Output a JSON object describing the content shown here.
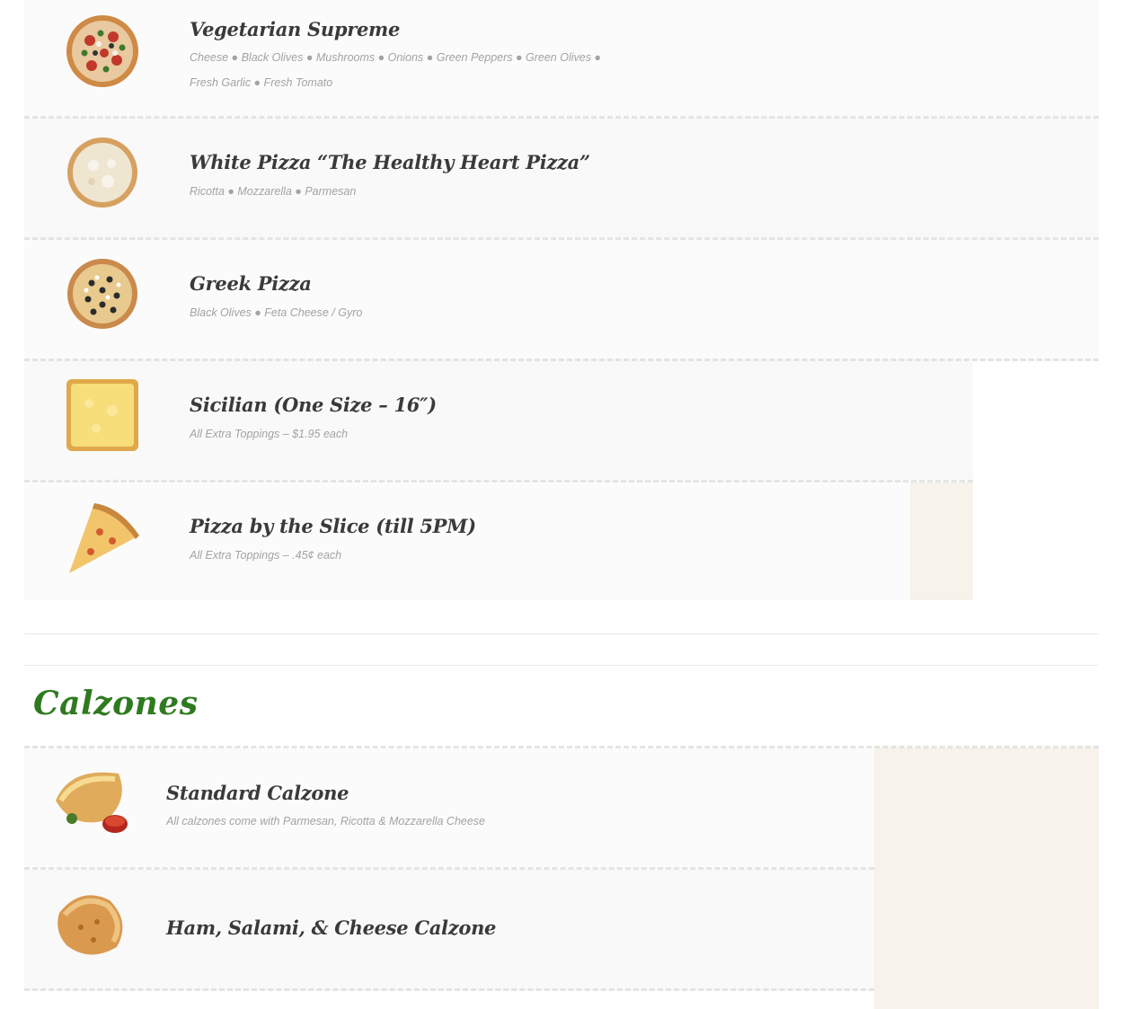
{
  "colors": {
    "section_heading": "#2f7a20",
    "item_title": "#3a3a3a",
    "item_description": "#a3a3a3",
    "price_column": "#f7f2ea",
    "row_divider": "#e4e4e4"
  },
  "pizzas": [
    {
      "title": "Vegetarian Supreme",
      "desc_line1": "Cheese ● Black Olives ● Mushrooms ● Onions ● Green Peppers ● Green Olives ●",
      "desc_line2": "Fresh Garlic ● Fresh Tomato",
      "icon": "vegetarian-pizza-icon"
    },
    {
      "title": "White Pizza “The Healthy Heart Pizza”",
      "desc_line1": "Ricotta ● Mozzarella ● Parmesan",
      "icon": "white-pizza-icon"
    },
    {
      "title": "Greek Pizza",
      "desc_line1": "Black Olives ● Feta Cheese / Gyro",
      "icon": "greek-pizza-icon"
    },
    {
      "title": "Sicilian (One Size – 16″)",
      "desc_line1": "All Extra Toppings – $1.95 each",
      "icon": "sicilian-pizza-icon"
    },
    {
      "title": "Pizza by the Slice (till 5PM)",
      "desc_line1": "All Extra Toppings – .45¢ each",
      "icon": "pizza-slice-icon"
    }
  ],
  "calzones_section": {
    "heading": "Calzones",
    "items": [
      {
        "title": "Standard Calzone",
        "desc_line1": "All calzones come with Parmesan, Ricotta & Mozzarella Cheese",
        "icon": "calzone-with-sauce-icon"
      },
      {
        "title": "Ham, Salami, & Cheese Calzone",
        "icon": "calzone-icon"
      }
    ]
  }
}
